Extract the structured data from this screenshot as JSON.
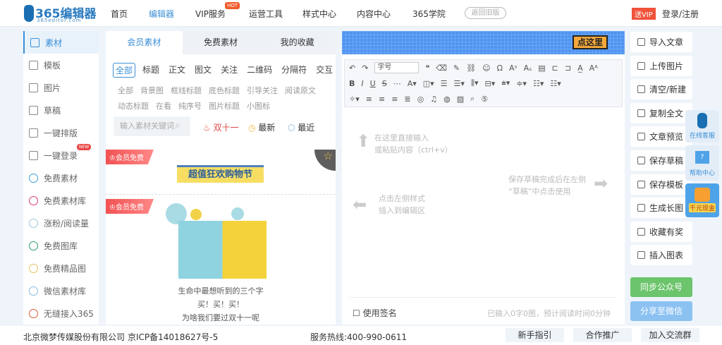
{
  "header": {
    "logo_main": "365编辑器",
    "logo_sub": "365editor.com",
    "nav": [
      "首页",
      "编辑器",
      "VIP服务",
      "运营工具",
      "样式中心",
      "内容中心",
      "365学院"
    ],
    "hot_badge": "HOT",
    "old_version": "返回旧版",
    "vip_badge": "送VIP",
    "login": "登录/注册"
  },
  "sidebar": {
    "items": [
      {
        "label": "素材",
        "icon": "folder-icon"
      },
      {
        "label": "模板",
        "icon": "layout-icon"
      },
      {
        "label": "图片",
        "icon": "image-icon"
      },
      {
        "label": "草稿",
        "icon": "draft-icon"
      },
      {
        "label": "一键排版",
        "icon": "list-icon"
      },
      {
        "label": "一键登录",
        "icon": "login-icon"
      },
      {
        "label": "免费素材",
        "icon": "material-icon"
      },
      {
        "label": "免费素材库",
        "icon": "library-icon"
      },
      {
        "label": "涨粉/阅读量",
        "icon": "book-icon"
      },
      {
        "label": "免费图库",
        "icon": "gallery-icon"
      },
      {
        "label": "免费精品图",
        "icon": "picture-icon"
      },
      {
        "label": "微信素材库",
        "icon": "wechat-icon"
      },
      {
        "label": "无缝接入365",
        "icon": "plug-icon"
      }
    ],
    "new_badge": "NEW"
  },
  "materials": {
    "tabs": [
      "会员素材",
      "免费素材",
      "我的收藏"
    ],
    "categories": [
      "全部",
      "标题",
      "正文",
      "图文",
      "关注",
      "二维码",
      "分隔符",
      "交互"
    ],
    "subcategories": [
      "全部",
      "背景图",
      "框线标题",
      "底色标题",
      "引导关注",
      "阅读原文",
      "动态标题",
      "在看",
      "纯序号",
      "图片标题",
      "小图标"
    ],
    "search_placeholder": "输入素材关键词",
    "filters": [
      "双十一",
      "最新",
      "最近"
    ],
    "badge": "会员免费",
    "card1_banner": "超值狂欢购物节",
    "card2_caption": [
      "生命中最想听到的三个字",
      "买！买！买！",
      "为啥我们要过双十一呢"
    ]
  },
  "editor": {
    "banner_button": "点这里",
    "font_size": "字号",
    "hint_input": [
      "在这里直接输入",
      "或粘贴内容（ctrl+v）"
    ],
    "hint_draft": [
      "保存草稿完成后在左侧",
      "“草稿”中点击使用"
    ],
    "hint_style": [
      "点击左侧样式",
      "插入到编辑区"
    ],
    "signature": "使用签名",
    "count": "已输入0字0图，预计阅读时间0分钟"
  },
  "actions": {
    "items": [
      "导入文章",
      "上传图片",
      "清空/新建",
      "复制全文",
      "文章预览",
      "保存草稿",
      "保存模板",
      "生成长图",
      "收藏有奖",
      "插入图表"
    ],
    "sync": "同步公众号",
    "share": "分享至微信"
  },
  "floating": {
    "service": "在线客服",
    "help": "帮助中心",
    "cash": "千元现金"
  },
  "footer": {
    "company": "北京微梦传媒股份有限公司",
    "icp": "京ICP备14018627号-5",
    "hotline": "服务热线:400-990-0611",
    "buttons": [
      "新手指引",
      "合作推广",
      "加入交流群"
    ]
  },
  "colors": {
    "accent": "#3b8fd6",
    "sync": "#6cc46c",
    "share": "#8cc2f2",
    "badge": "#f25252"
  }
}
